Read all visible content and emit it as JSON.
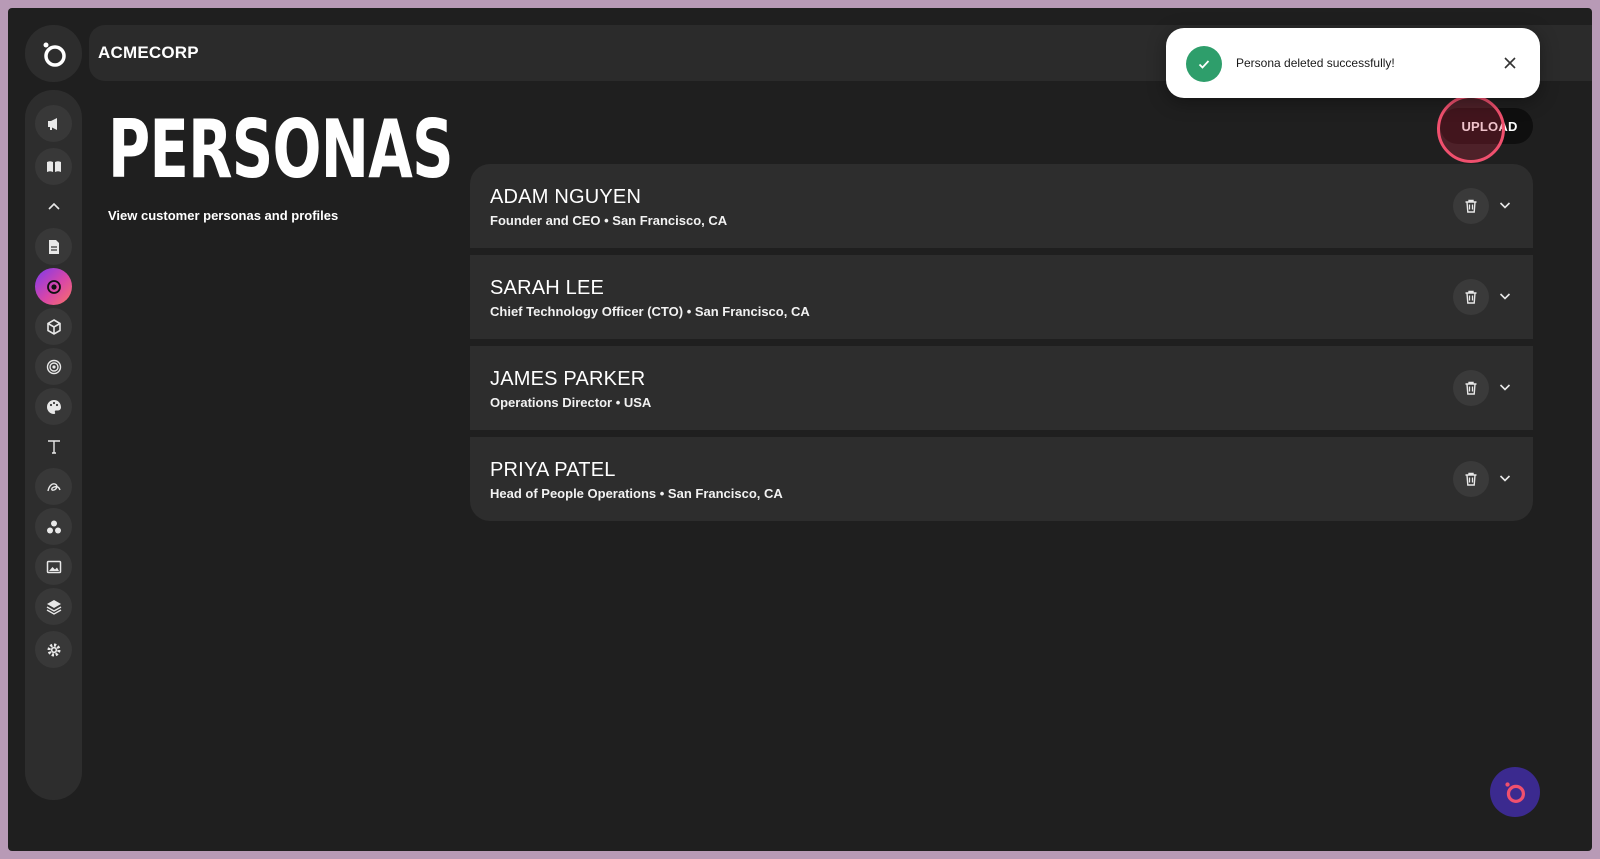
{
  "header": {
    "brand": "ACMECORP"
  },
  "page": {
    "title": "PERSONAS",
    "subtitle": "View customer personas and profiles",
    "upload_label": "UPLOAD"
  },
  "sidebar": {
    "items": [
      {
        "icon": "megaphone-icon"
      },
      {
        "icon": "book-icon"
      },
      {
        "icon": "chevron-up-icon"
      },
      {
        "icon": "document-icon"
      },
      {
        "icon": "persona-icon",
        "active": true
      },
      {
        "icon": "cube-icon"
      },
      {
        "icon": "target-icon"
      },
      {
        "icon": "palette-icon"
      },
      {
        "icon": "text-icon"
      },
      {
        "icon": "signature-icon"
      },
      {
        "icon": "circles-icon"
      },
      {
        "icon": "image-icon"
      },
      {
        "icon": "layers-icon"
      },
      {
        "icon": "gear-icon"
      }
    ]
  },
  "personas": [
    {
      "name": "ADAM NGUYEN",
      "subtitle": "Founder and CEO • San Francisco, CA"
    },
    {
      "name": "SARAH LEE",
      "subtitle": "Chief Technology Officer (CTO) • San Francisco, CA"
    },
    {
      "name": "JAMES PARKER",
      "subtitle": "Operations Director • USA"
    },
    {
      "name": "PRIYA PATEL",
      "subtitle": "Head of People Operations • San Francisco, CA"
    }
  ],
  "toast": {
    "message": "Persona deleted successfully!"
  },
  "colors": {
    "background": "#1f1f1f",
    "panel": "#2d2d2d",
    "success": "#2e9e6b",
    "highlight": "#f0506e",
    "accent_gradient": [
      "#7c3aed",
      "#d946a8",
      "#f97366"
    ]
  }
}
